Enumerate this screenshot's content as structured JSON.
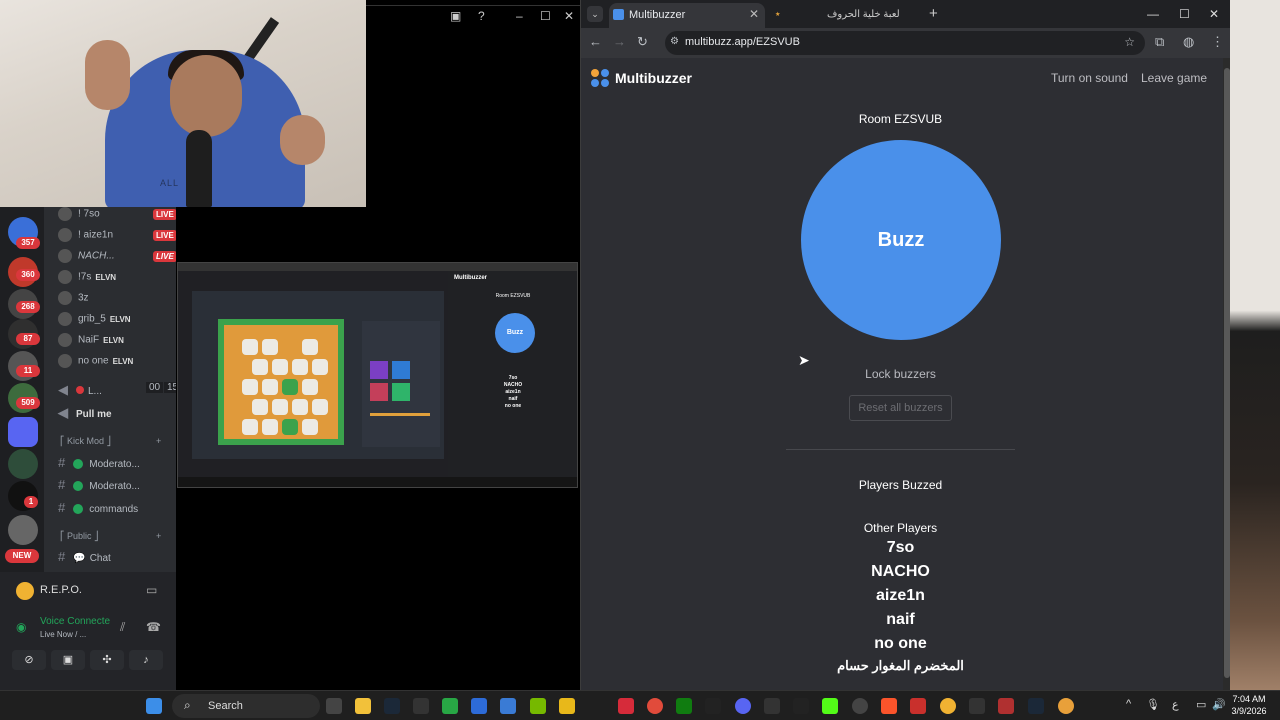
{
  "webcam": {
    "shirt_text": "ALL"
  },
  "discord": {
    "guild_badges": [
      "357",
      "360",
      "268",
      "87",
      "11",
      "509",
      "1"
    ],
    "new_label": "NEW",
    "voice_users": [
      {
        "name": "! 7so",
        "badge": "LIVE"
      },
      {
        "name": "! aize1n",
        "badge": "LIVE"
      },
      {
        "name": "NACH...",
        "badge": "LIVE"
      },
      {
        "name": "!7s",
        "badge": "ELVN"
      },
      {
        "name": "3z",
        "badge": ""
      },
      {
        "name": "grib_5",
        "badge": "ELVN"
      },
      {
        "name": "NaiF",
        "badge": "ELVN"
      },
      {
        "name": "no one",
        "badge": "ELVN"
      }
    ],
    "channel_l": "L...",
    "channel_l_counts": [
      "00",
      "15"
    ],
    "pull_me": "Pull me",
    "kick_mod_section": "⎡ Kick Mod ⎦",
    "mod_channels": [
      "Moderato...",
      "Moderato...",
      "commands"
    ],
    "public_section": "⎡ Public ⎦",
    "chat_channel": "Chat",
    "activity": "R.E.P.O.",
    "voice_connected": "Voice Connecte",
    "live_now": "Live Now / ..."
  },
  "browser": {
    "tab_active": "Multibuzzer",
    "tab_second": "لعبة خلية الحروف",
    "url": "multibuzz.app/EZSVUB"
  },
  "multibuzzer": {
    "brand": "Multibuzzer",
    "turn_on_sound": "Turn on sound",
    "leave_game": "Leave game",
    "room": "Room EZSVUB",
    "buzz": "Buzz",
    "lock_buzzers": "Lock buzzers",
    "reset_all": "Reset all buzzers",
    "players_buzzed": "Players Buzzed",
    "other_players": "Other Players",
    "players": [
      "7so",
      "NACHO",
      "aize1n",
      "naif",
      "no one",
      "المخضرم المغوار حسام"
    ]
  },
  "mini_screen": {
    "brand": "Multibuzzer",
    "room": "Room EZSVUB",
    "buzz": "Buzz",
    "players": [
      "7so",
      "NACHO",
      "aize1n",
      "naif",
      "no one"
    ]
  },
  "taskbar": {
    "search": "Search",
    "time": "7:04 AM",
    "date": "3/9/2026"
  },
  "colors": {
    "buzz_blue": "#4a90ea",
    "page_bg": "#2d2e33",
    "live_red": "#da373c",
    "discord_green": "#23a55a"
  }
}
